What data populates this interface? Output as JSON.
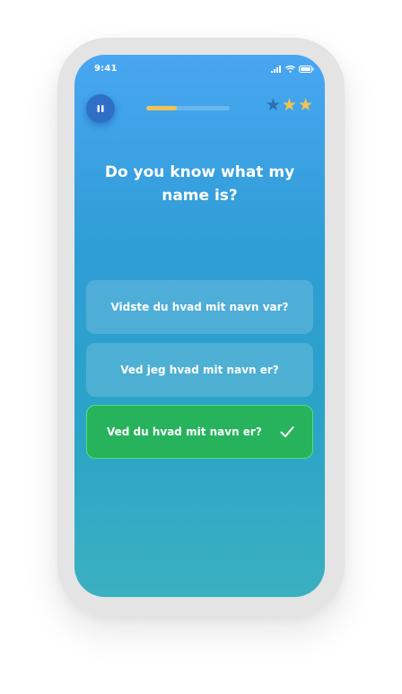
{
  "status_bar": {
    "time": "9:41",
    "icons": [
      "signal-icon",
      "wifi-icon",
      "battery-icon"
    ]
  },
  "header": {
    "pause_icon": "pause-icon",
    "progress_fraction": 0.37,
    "stars_total": 3,
    "stars_filled": 2
  },
  "question": {
    "text": "Do you know what my name is?"
  },
  "options": [
    {
      "label": "Vidste du hvad mit navn var?",
      "state": "default"
    },
    {
      "label": "Ved jeg hvad mit navn er?",
      "state": "default"
    },
    {
      "label": "Ved du hvad mit navn er?",
      "state": "correct"
    }
  ],
  "colors": {
    "gradient_top": "#49a6f2",
    "gradient_bottom": "#3bb0c1",
    "correct_green": "#27b35c",
    "star_gold": "#f2c451",
    "pause_blue": "#2f6fc6"
  }
}
